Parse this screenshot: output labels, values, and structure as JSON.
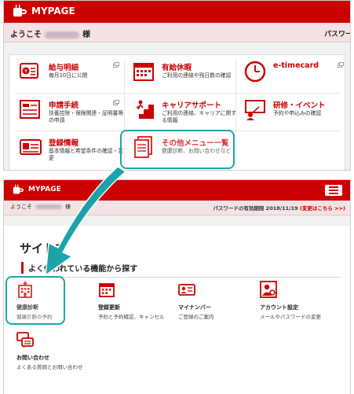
{
  "top": {
    "brand": "MYPAGE",
    "welcome_prefix": "ようこそ",
    "welcome_suffix": "様",
    "welcome_right": "パスワードの",
    "tiles": [
      {
        "title": "給与明細",
        "desc": "毎月10日に公開",
        "icon": "yen-receipt-icon"
      },
      {
        "title": "有給休暇",
        "desc": "ご利用の連絡や残日数の確認",
        "icon": "calendar-icon"
      },
      {
        "title": "e-timecard",
        "desc": "",
        "icon": "clock-icon"
      },
      {
        "title": "申請手続",
        "desc": "扶養控除・保険関連・証明書等の申請",
        "icon": "form-icon"
      },
      {
        "title": "キャリアサポート",
        "desc": "ご利用の連絡、キャリアに関する情報",
        "icon": "career-stairs-icon"
      },
      {
        "title": "研修・イベント",
        "desc": "予約や申込みの確認",
        "icon": "presentation-icon"
      },
      {
        "title": "登録情報",
        "desc": "基本情報と希望条件の確認・変更",
        "icon": "id-card-icon"
      },
      {
        "title": "その他メニュー一覧",
        "desc": "健康診断、お問い合わせなど",
        "icon": "documents-icon"
      }
    ]
  },
  "bottom": {
    "brand": "MYPAGE",
    "welcome_prefix": "ようこそ",
    "welcome_suffix": "様",
    "password_notice": "パスワードの有効期限 2018/11/19",
    "password_change": "(変更はこちら >>)",
    "page_title": "サイトマ",
    "section_title": "よく使われている機能から探す",
    "items": [
      {
        "title": "健康診断",
        "desc": "健康診断の予約",
        "icon": "hospital-icon"
      },
      {
        "title": "登録更新",
        "desc": "予約と予約確認、キャンセル",
        "icon": "calendar-icon"
      },
      {
        "title": "マイナンバー",
        "desc": "ご登録のご案内",
        "icon": "mynumber-card-icon"
      },
      {
        "title": "アカウント設定",
        "desc": "メールやパスワードの変更",
        "icon": "account-settings-icon"
      },
      {
        "title": "お問い合わせ",
        "desc": "よくある質問とお問い合わせ",
        "icon": "chat-icon"
      }
    ]
  },
  "colors": {
    "brand_red": "#cc0000",
    "highlight": "#1aa7a7",
    "welcome_bg": "#f5e3e3"
  }
}
